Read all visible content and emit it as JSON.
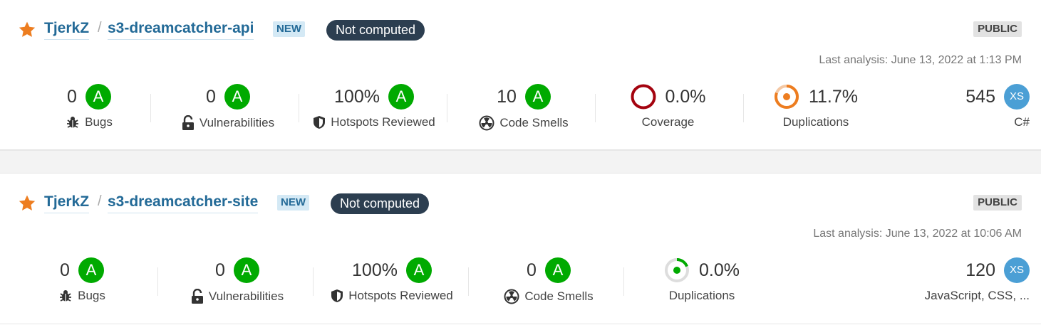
{
  "colors": {
    "link": "#236a97",
    "rating_a": "#00aa00",
    "quality_gate_bg": "#2c3e50",
    "size_badge": "#4b9fd5",
    "coverage_ring": "#a4030f",
    "duplication_ring": "#ed7d20",
    "duplication_ring_low": "#00aa00"
  },
  "projects": [
    {
      "owner": "TjerkZ",
      "separator": "/",
      "name": "s3-dreamcatcher-api",
      "new_badge": "NEW",
      "quality_gate": "Not computed",
      "visibility": "PUBLIC",
      "last_analysis": "Last analysis: June 13, 2022 at 1:13 PM",
      "bugs": {
        "value": "0",
        "rating": "A",
        "label": "Bugs"
      },
      "vulnerabilities": {
        "value": "0",
        "rating": "A",
        "label": "Vulnerabilities"
      },
      "hotspots": {
        "value": "100%",
        "rating": "A",
        "label": "Hotspots Reviewed"
      },
      "code_smells": {
        "value": "10",
        "rating": "A",
        "label": "Code Smells"
      },
      "coverage": {
        "value": "0.0%",
        "label": "Coverage"
      },
      "duplications": {
        "value": "11.7%",
        "label": "Duplications"
      },
      "size": {
        "value": "545",
        "badge": "XS",
        "languages": "C#"
      }
    },
    {
      "owner": "TjerkZ",
      "separator": "/",
      "name": "s3-dreamcatcher-site",
      "new_badge": "NEW",
      "quality_gate": "Not computed",
      "visibility": "PUBLIC",
      "last_analysis": "Last analysis: June 13, 2022 at 10:06 AM",
      "bugs": {
        "value": "0",
        "rating": "A",
        "label": "Bugs"
      },
      "vulnerabilities": {
        "value": "0",
        "rating": "A",
        "label": "Vulnerabilities"
      },
      "hotspots": {
        "value": "100%",
        "rating": "A",
        "label": "Hotspots Reviewed"
      },
      "code_smells": {
        "value": "0",
        "rating": "A",
        "label": "Code Smells"
      },
      "duplications": {
        "value": "0.0%",
        "label": "Duplications"
      },
      "size": {
        "value": "120",
        "badge": "XS",
        "languages": "JavaScript, CSS, ..."
      }
    }
  ]
}
